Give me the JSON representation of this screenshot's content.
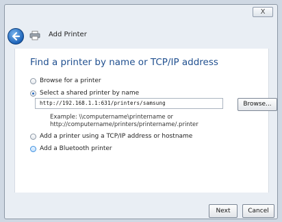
{
  "window": {
    "close_glyph": "X"
  },
  "header": {
    "title": "Add Printer"
  },
  "main": {
    "heading": "Find a printer by name or TCP/IP address",
    "options": [
      {
        "label": "Browse for a printer",
        "checked": false
      },
      {
        "label": "Select a shared printer by name",
        "checked": true
      },
      {
        "label": "Add a printer using a TCP/IP address or hostname",
        "checked": false
      },
      {
        "label": "Add a Bluetooth printer",
        "checked": false
      }
    ],
    "shared_printer_value": "http://192.168.1.1:631/printers/samsung",
    "browse_label": "Browse...",
    "example_line1": "Example: \\\\computername\\printername or",
    "example_line2": "http://computername/printers/printername/.printer"
  },
  "footer": {
    "next_label": "Next",
    "cancel_label": "Cancel"
  },
  "colors": {
    "heading": "#1f4f8f",
    "accent": "#2468c0"
  }
}
